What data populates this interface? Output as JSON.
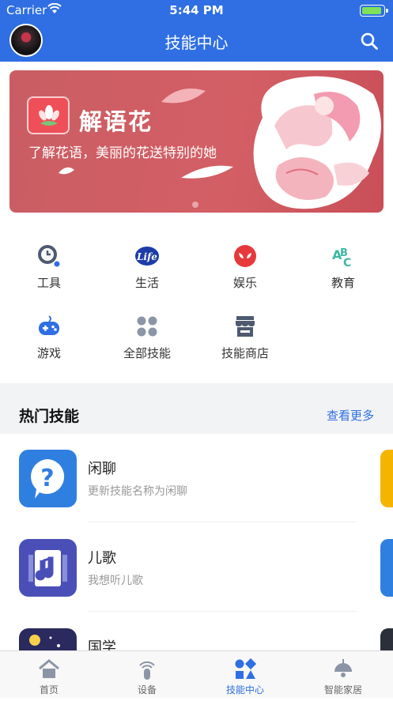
{
  "status_bar": {
    "carrier": "Carrier",
    "time": "5:44 PM"
  },
  "nav": {
    "title": "技能中心"
  },
  "banner": {
    "title": "解语花",
    "subtitle": "了解花语，美丽的花送特别的她"
  },
  "categories": [
    {
      "label": "工具",
      "icon": "clock-icon"
    },
    {
      "label": "生活",
      "icon": "life-icon"
    },
    {
      "label": "娱乐",
      "icon": "spiderman-icon"
    },
    {
      "label": "教育",
      "icon": "abc-icon"
    },
    {
      "label": "游戏",
      "icon": "gamepad-icon"
    },
    {
      "label": "全部技能",
      "icon": "grid-icon"
    },
    {
      "label": "技能商店",
      "icon": "store-icon"
    }
  ],
  "hot": {
    "title": "热门技能",
    "more": "查看更多",
    "items": [
      {
        "name": "闲聊",
        "desc": "更新技能名称为闲聊",
        "color": "#2f7fe0"
      },
      {
        "name": "儿歌",
        "desc": "我想听儿歌",
        "color": "#4a4fb8"
      },
      {
        "name": "国学",
        "desc": "",
        "color": "#2a2a5e"
      }
    ]
  },
  "tabs": [
    {
      "label": "首页",
      "active": false
    },
    {
      "label": "设备",
      "active": false
    },
    {
      "label": "技能中心",
      "active": true
    },
    {
      "label": "智能家居",
      "active": false
    }
  ],
  "colors": {
    "brand": "#2f6fe3",
    "banner": "#d35f65"
  }
}
